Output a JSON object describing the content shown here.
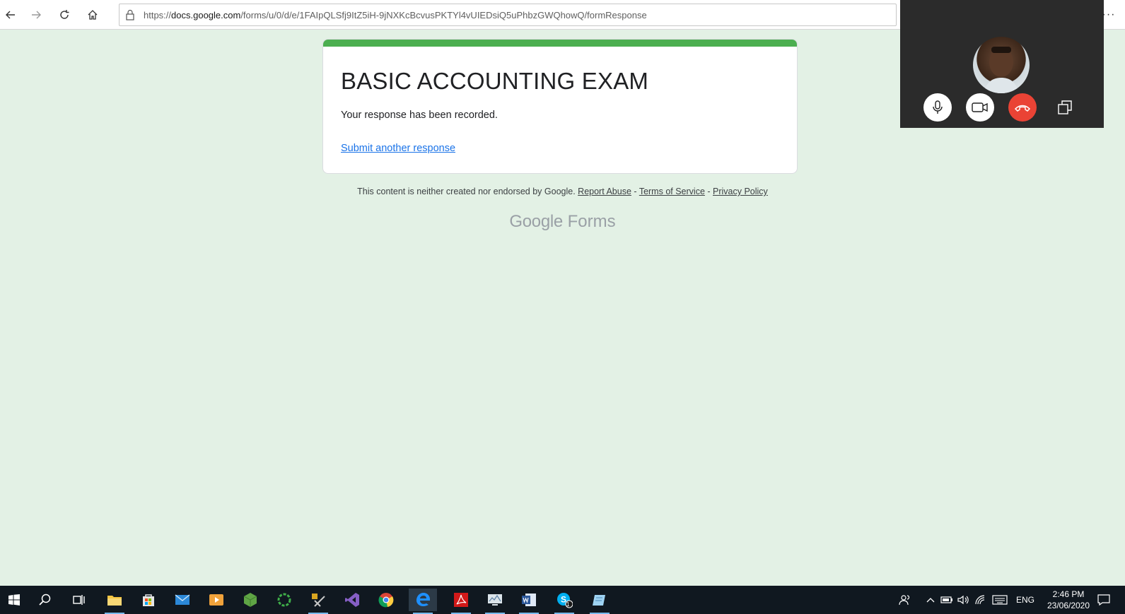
{
  "browser": {
    "url_prefix": "https://",
    "url_host": "docs.google.com",
    "url_path": "/forms/u/0/d/e/1FAIpQLSfj9ItZ5iH-9jNXKcBcvusPKTYl4vUIEDsiQ5uPhbzGWQhowQ/formResponse",
    "more_label": "···"
  },
  "form": {
    "title": "BASIC ACCOUNTING EXAM",
    "message": "Your response has been recorded.",
    "submit_another": "Submit another response"
  },
  "footer": {
    "disclaimer": "This content is neither created nor endorsed by Google.",
    "report_abuse": "Report Abuse",
    "sep1": " - ",
    "terms": "Terms of Service",
    "sep2": " - ",
    "privacy": "Privacy Policy",
    "brand_google": "Google",
    "brand_forms": "Forms"
  },
  "taskbar": {
    "skype_badge": "1",
    "language": "ENG",
    "time": "2:46 PM",
    "date": "23/06/2020"
  },
  "colors": {
    "page_bg": "#e3f1e5",
    "accent": "#4caf50",
    "link": "#1a73e8",
    "end_call": "#ea4335"
  }
}
